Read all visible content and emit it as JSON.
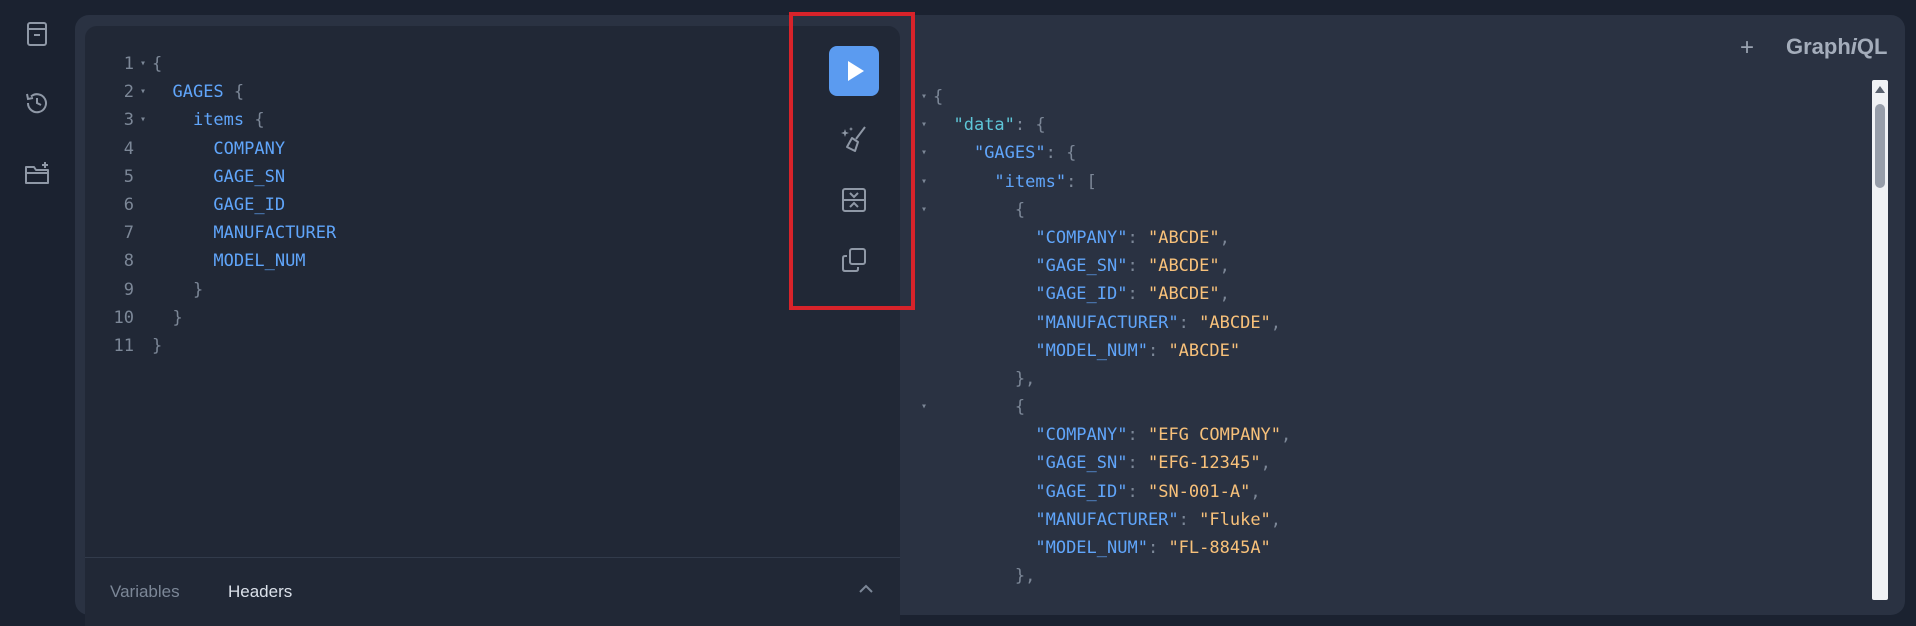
{
  "sidebar": {
    "icons": [
      "docs-icon",
      "history-icon",
      "add-folder-icon"
    ]
  },
  "header": {
    "add_tab_label": "+",
    "brand": {
      "prefix": "Graph",
      "italic": "i",
      "suffix": "QL"
    }
  },
  "query": {
    "lines": [
      {
        "num": "1",
        "fold": true,
        "indent": "",
        "tokens": [
          {
            "t": "{",
            "c": "punc"
          }
        ]
      },
      {
        "num": "2",
        "fold": true,
        "indent": "  ",
        "tokens": [
          {
            "t": "GAGES",
            "c": "kw-type"
          },
          {
            "t": " {",
            "c": "punc"
          }
        ]
      },
      {
        "num": "3",
        "fold": true,
        "indent": "    ",
        "tokens": [
          {
            "t": "items",
            "c": "kw-field"
          },
          {
            "t": " {",
            "c": "punc"
          }
        ]
      },
      {
        "num": "4",
        "fold": false,
        "indent": "      ",
        "tokens": [
          {
            "t": "COMPANY",
            "c": "kw-field"
          }
        ]
      },
      {
        "num": "5",
        "fold": false,
        "indent": "      ",
        "tokens": [
          {
            "t": "GAGE_SN",
            "c": "kw-field"
          }
        ]
      },
      {
        "num": "6",
        "fold": false,
        "indent": "      ",
        "tokens": [
          {
            "t": "GAGE_ID",
            "c": "kw-field"
          }
        ]
      },
      {
        "num": "7",
        "fold": false,
        "indent": "      ",
        "tokens": [
          {
            "t": "MANUFACTURER",
            "c": "kw-field"
          }
        ]
      },
      {
        "num": "8",
        "fold": false,
        "indent": "      ",
        "tokens": [
          {
            "t": "MODEL_NUM",
            "c": "kw-field"
          }
        ]
      },
      {
        "num": "9",
        "fold": false,
        "indent": "    ",
        "tokens": [
          {
            "t": "}",
            "c": "punc"
          }
        ]
      },
      {
        "num": "10",
        "fold": false,
        "indent": "  ",
        "tokens": [
          {
            "t": "}",
            "c": "punc"
          }
        ]
      },
      {
        "num": "11",
        "fold": false,
        "indent": "",
        "tokens": [
          {
            "t": "}",
            "c": "punc"
          }
        ]
      }
    ]
  },
  "toolbar": {
    "run_label": "Execute query",
    "tools": [
      "prettify-icon",
      "merge-fragments-icon",
      "copy-icon"
    ]
  },
  "editor_tabs": {
    "variables": "Variables",
    "headers": "Headers"
  },
  "response": {
    "lines": [
      {
        "fold": true,
        "indent": "",
        "tokens": [
          {
            "t": "{",
            "c": "punc"
          }
        ]
      },
      {
        "fold": true,
        "indent": "  ",
        "tokens": [
          {
            "t": "\"data\"",
            "c": "key-data"
          },
          {
            "t": ": {",
            "c": "punc"
          }
        ]
      },
      {
        "fold": true,
        "indent": "    ",
        "tokens": [
          {
            "t": "\"GAGES\"",
            "c": "key"
          },
          {
            "t": ": {",
            "c": "punc"
          }
        ]
      },
      {
        "fold": true,
        "indent": "      ",
        "tokens": [
          {
            "t": "\"items\"",
            "c": "key"
          },
          {
            "t": ": [",
            "c": "punc"
          }
        ]
      },
      {
        "fold": true,
        "indent": "        ",
        "tokens": [
          {
            "t": "{",
            "c": "punc"
          }
        ]
      },
      {
        "fold": false,
        "indent": "          ",
        "tokens": [
          {
            "t": "\"COMPANY\"",
            "c": "key"
          },
          {
            "t": ": ",
            "c": "punc"
          },
          {
            "t": "\"ABCDE\"",
            "c": "str"
          },
          {
            "t": ",",
            "c": "punc"
          }
        ]
      },
      {
        "fold": false,
        "indent": "          ",
        "tokens": [
          {
            "t": "\"GAGE_SN\"",
            "c": "key"
          },
          {
            "t": ": ",
            "c": "punc"
          },
          {
            "t": "\"ABCDE\"",
            "c": "str"
          },
          {
            "t": ",",
            "c": "punc"
          }
        ]
      },
      {
        "fold": false,
        "indent": "          ",
        "tokens": [
          {
            "t": "\"GAGE_ID\"",
            "c": "key"
          },
          {
            "t": ": ",
            "c": "punc"
          },
          {
            "t": "\"ABCDE\"",
            "c": "str"
          },
          {
            "t": ",",
            "c": "punc"
          }
        ]
      },
      {
        "fold": false,
        "indent": "          ",
        "tokens": [
          {
            "t": "\"MANUFACTURER\"",
            "c": "key"
          },
          {
            "t": ": ",
            "c": "punc"
          },
          {
            "t": "\"ABCDE\"",
            "c": "str"
          },
          {
            "t": ",",
            "c": "punc"
          }
        ]
      },
      {
        "fold": false,
        "indent": "          ",
        "tokens": [
          {
            "t": "\"MODEL_NUM\"",
            "c": "key"
          },
          {
            "t": ": ",
            "c": "punc"
          },
          {
            "t": "\"ABCDE\"",
            "c": "str"
          }
        ]
      },
      {
        "fold": false,
        "indent": "        ",
        "tokens": [
          {
            "t": "},",
            "c": "punc"
          }
        ]
      },
      {
        "fold": true,
        "indent": "        ",
        "tokens": [
          {
            "t": "{",
            "c": "punc"
          }
        ]
      },
      {
        "fold": false,
        "indent": "          ",
        "tokens": [
          {
            "t": "\"COMPANY\"",
            "c": "key"
          },
          {
            "t": ": ",
            "c": "punc"
          },
          {
            "t": "\"EFG COMPANY\"",
            "c": "str"
          },
          {
            "t": ",",
            "c": "punc"
          }
        ]
      },
      {
        "fold": false,
        "indent": "          ",
        "tokens": [
          {
            "t": "\"GAGE_SN\"",
            "c": "key"
          },
          {
            "t": ": ",
            "c": "punc"
          },
          {
            "t": "\"EFG-12345\"",
            "c": "str"
          },
          {
            "t": ",",
            "c": "punc"
          }
        ]
      },
      {
        "fold": false,
        "indent": "          ",
        "tokens": [
          {
            "t": "\"GAGE_ID\"",
            "c": "key"
          },
          {
            "t": ": ",
            "c": "punc"
          },
          {
            "t": "\"SN-001-A\"",
            "c": "str"
          },
          {
            "t": ",",
            "c": "punc"
          }
        ]
      },
      {
        "fold": false,
        "indent": "          ",
        "tokens": [
          {
            "t": "\"MANUFACTURER\"",
            "c": "key"
          },
          {
            "t": ": ",
            "c": "punc"
          },
          {
            "t": "\"Fluke\"",
            "c": "str"
          },
          {
            "t": ",",
            "c": "punc"
          }
        ]
      },
      {
        "fold": false,
        "indent": "          ",
        "tokens": [
          {
            "t": "\"MODEL_NUM\"",
            "c": "key"
          },
          {
            "t": ": ",
            "c": "punc"
          },
          {
            "t": "\"FL-8845A\"",
            "c": "str"
          }
        ]
      },
      {
        "fold": false,
        "indent": "        ",
        "tokens": [
          {
            "t": "},",
            "c": "punc"
          }
        ]
      }
    ]
  },
  "colors": {
    "accent": "#5b9bf0",
    "highlight_border": "#d8232a",
    "key": "#60a5fa",
    "string": "#f8c17a"
  }
}
